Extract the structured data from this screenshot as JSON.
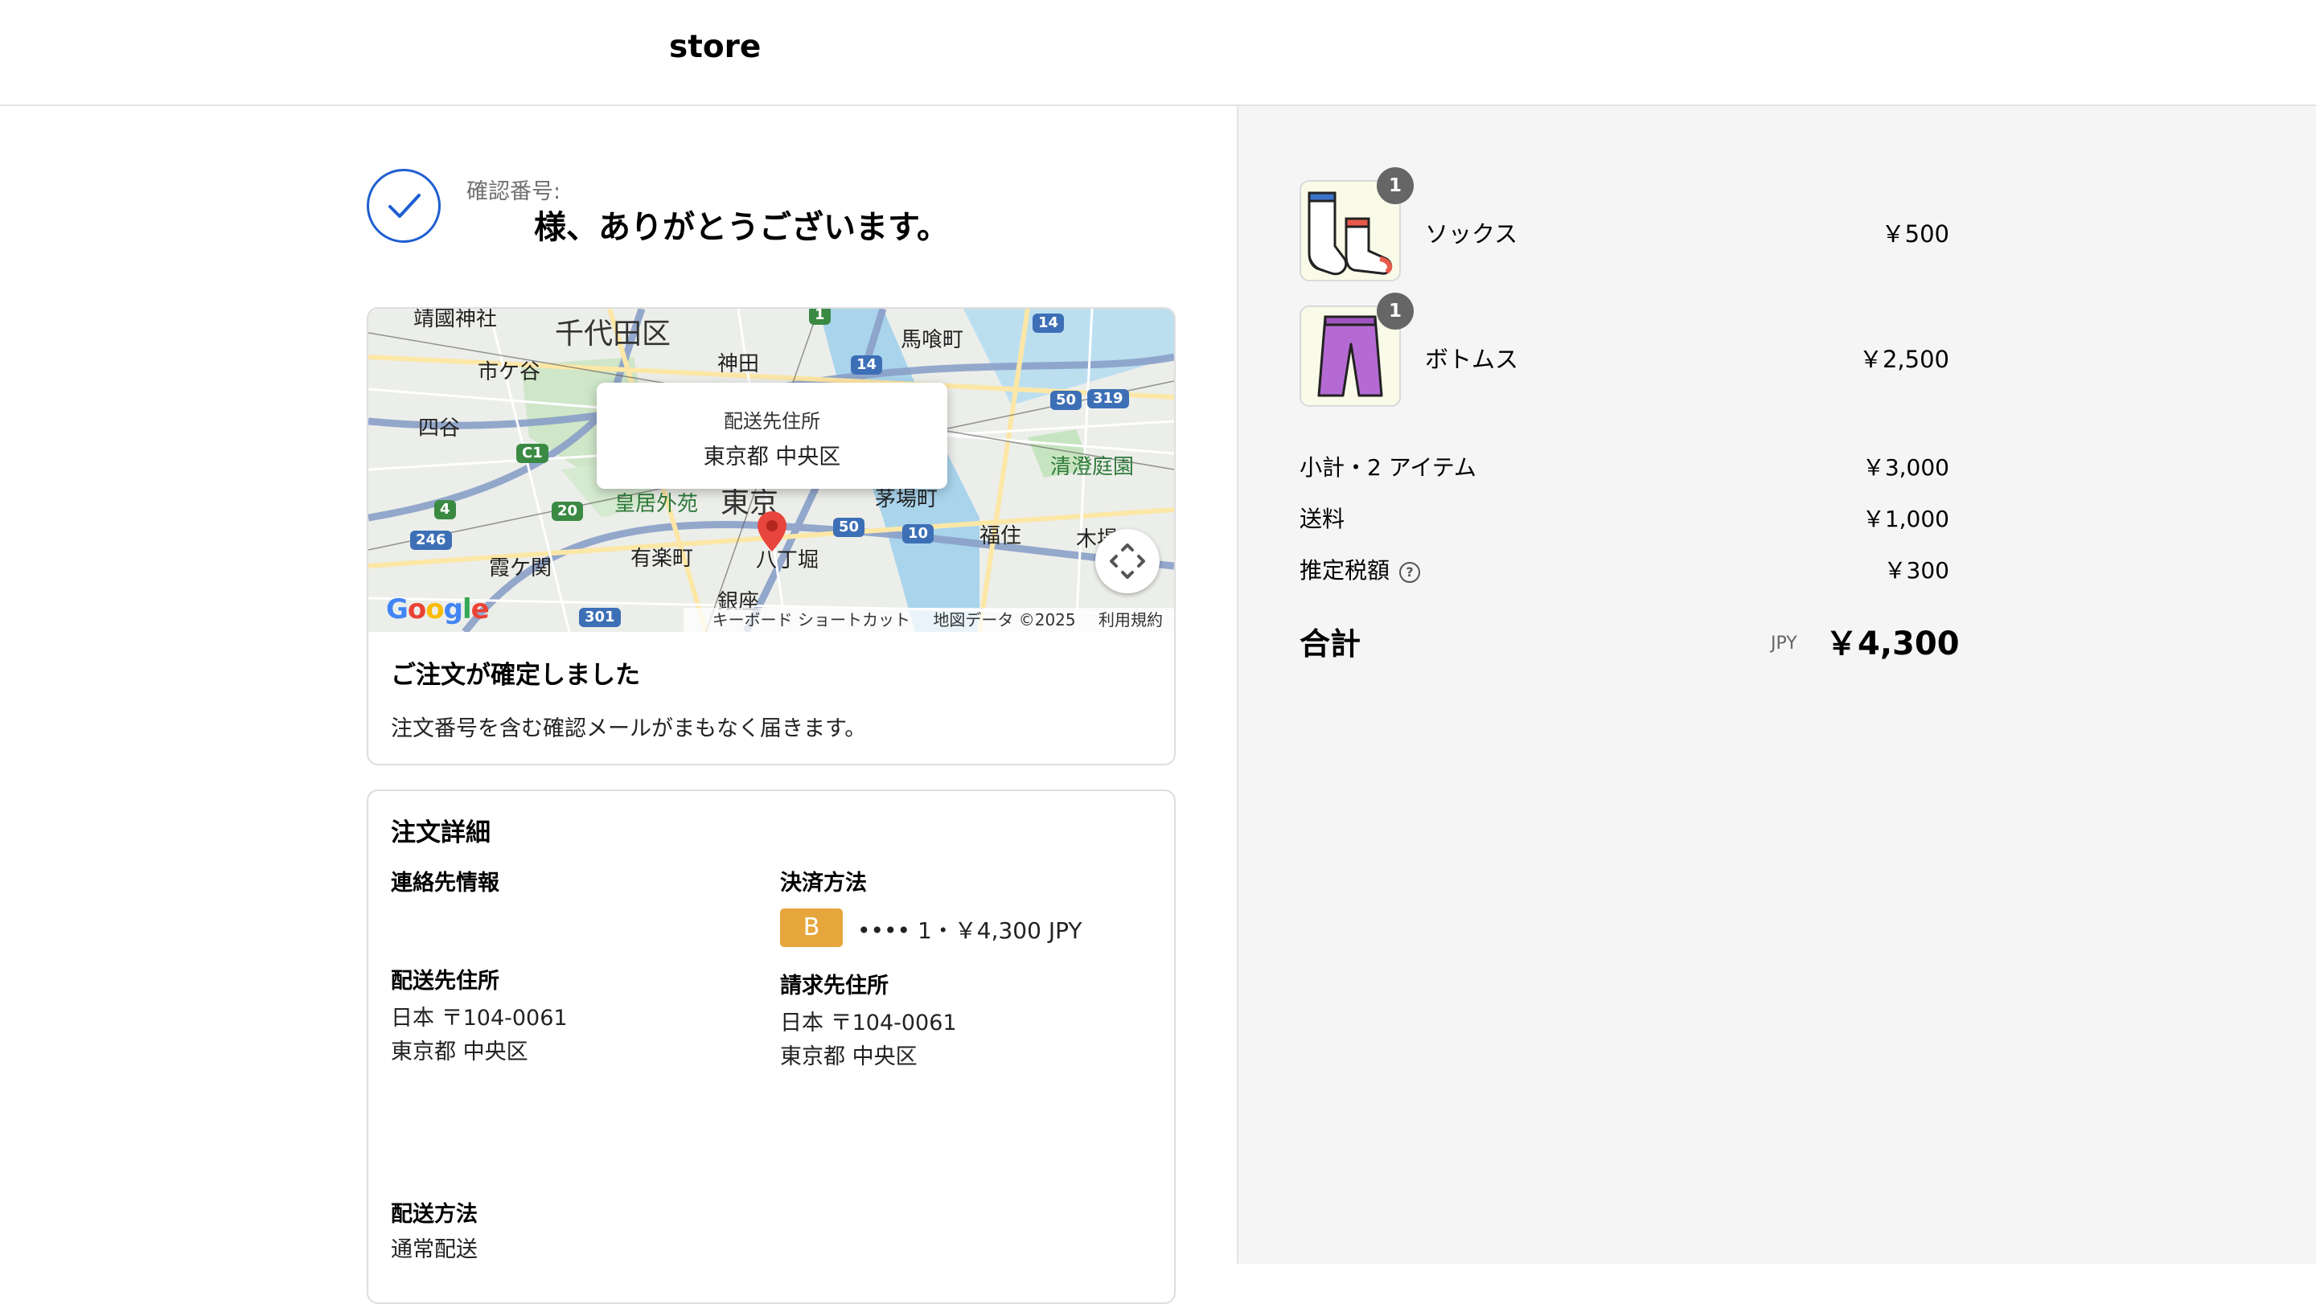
{
  "header": {
    "store_name": "store"
  },
  "confirmation": {
    "number_label": "確認番号:",
    "thank_you": "様、ありがとうございます。",
    "accent_color": "#1f5ed1"
  },
  "map": {
    "labels": {
      "chiyoda": "千代田区",
      "kanda": "神田",
      "ichigaya": "市ケ谷",
      "yotsuya": "四谷",
      "bakurocho": "馬喰町",
      "kiyosumi": "清澄庭園",
      "kokyo": "皇居外苑",
      "tokyo": "東京",
      "kayabacho": "茅場町",
      "fukuzumi": "福住",
      "kasumigaseki": "霞ケ関",
      "yurakucho": "有楽町",
      "hatchobori": "八丁堀",
      "ginza": "銀座",
      "yasukuni": "靖國神社",
      "kiba": "木場"
    },
    "route_numbers": [
      "14",
      "14",
      "50",
      "319",
      "C1",
      "20",
      "4",
      "246",
      "50",
      "10",
      "301",
      "1"
    ],
    "tooltip_title": "配送先住所",
    "tooltip_address": "東京都 中央区",
    "google": "Google",
    "attribution": {
      "keyboard": "キーボード ショートカット",
      "map_data": "地図データ ©2025",
      "terms": "利用規約"
    }
  },
  "order_confirmed": {
    "title": "ご注文が確定しました",
    "body": "注文番号を含む確認メールがまもなく届きます。"
  },
  "details": {
    "title": "注文詳細",
    "contact_heading": "連絡先情報",
    "payment_heading": "決済方法",
    "payment_badge": "B",
    "payment_text": "•••• 1・￥4,300 JPY",
    "shipping_heading": "配送先住所",
    "shipping_line1": "日本 〒104-0061",
    "shipping_line2": "東京都 中央区",
    "billing_heading": "請求先住所",
    "billing_line1": "日本 〒104-0061",
    "billing_line2": "東京都 中央区",
    "method_heading": "配送方法",
    "method_value": "通常配送"
  },
  "summary": {
    "items": [
      {
        "name": "ソックス",
        "price": "￥500",
        "qty": "1"
      },
      {
        "name": "ボトムス",
        "price": "￥2,500",
        "qty": "1"
      }
    ],
    "subtotal_label": "小計・2 アイテム",
    "subtotal": "￥3,000",
    "shipping_label": "送料",
    "shipping": "￥1,000",
    "tax_label": "推定税額",
    "tax": "￥300",
    "total_label": "合計",
    "currency": "JPY",
    "total": "￥4,300"
  }
}
